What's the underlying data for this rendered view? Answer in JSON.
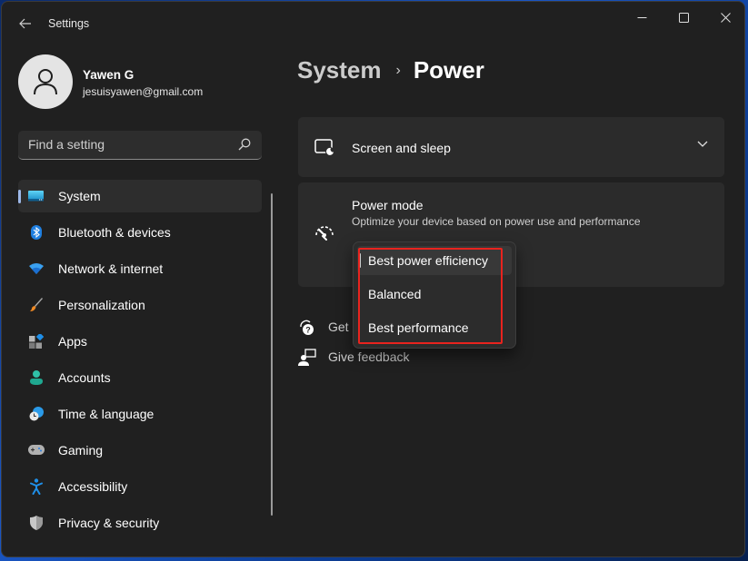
{
  "window": {
    "title": "Settings",
    "controls": {
      "minimize": "minimize",
      "maximize": "maximize",
      "close": "close"
    }
  },
  "profile": {
    "name": "Yawen G",
    "email": "jesuisyawen@gmail.com"
  },
  "search": {
    "placeholder": "Find a setting",
    "value": ""
  },
  "sidebar": {
    "items": [
      {
        "label": "System",
        "icon": "system-monitor-icon",
        "active": true
      },
      {
        "label": "Bluetooth & devices",
        "icon": "bluetooth-icon",
        "active": false
      },
      {
        "label": "Network & internet",
        "icon": "wifi-icon",
        "active": false
      },
      {
        "label": "Personalization",
        "icon": "paintbrush-icon",
        "active": false
      },
      {
        "label": "Apps",
        "icon": "apps-icon",
        "active": false
      },
      {
        "label": "Accounts",
        "icon": "person-icon",
        "active": false
      },
      {
        "label": "Time & language",
        "icon": "clock-globe-icon",
        "active": false
      },
      {
        "label": "Gaming",
        "icon": "gamepad-icon",
        "active": false
      },
      {
        "label": "Accessibility",
        "icon": "accessibility-icon",
        "active": false
      },
      {
        "label": "Privacy & security",
        "icon": "shield-icon",
        "active": false
      }
    ]
  },
  "main": {
    "breadcrumb": {
      "parent": "System",
      "separator": "›",
      "current": "Power"
    },
    "cards": {
      "screen_sleep": {
        "title": "Screen and sleep"
      },
      "power_mode": {
        "title": "Power mode",
        "description": "Optimize your device based on power use and performance"
      }
    },
    "links": {
      "get_help": "Get help",
      "give_feedback": "Give feedback"
    },
    "power_mode_dropdown": {
      "selected": "Best power efficiency",
      "options": [
        "Best power efficiency",
        "Balanced",
        "Best performance"
      ]
    }
  },
  "colors": {
    "window_bg": "#202020",
    "card_bg": "#2b2b2b",
    "accent_pill": "#9db8e8",
    "annotation_red": "#e8231e"
  }
}
